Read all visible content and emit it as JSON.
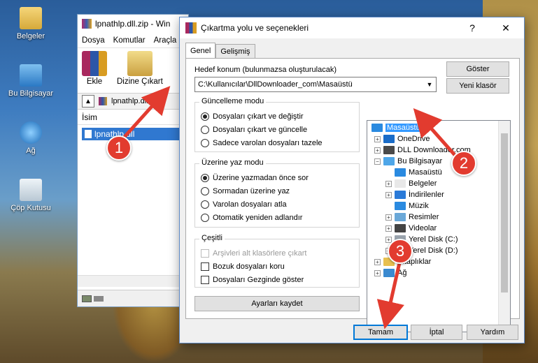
{
  "desktop": {
    "icons": [
      {
        "label": "Belgeler"
      },
      {
        "label": "Bu Bilgisayar"
      },
      {
        "label": "Ağ"
      },
      {
        "label": "Çöp Kutusu"
      }
    ]
  },
  "winrar": {
    "title": "lpnathlp.dll.zip - Win",
    "menu": [
      "Dosya",
      "Komutlar",
      "Araçla"
    ],
    "toolbar": {
      "add": "Ekle",
      "extract": "Dizine Çıkart"
    },
    "address": "lpnathlp.dll.",
    "column_name": "İsim",
    "file": "lpnathlp.dll"
  },
  "dialog": {
    "title": "Çıkartma yolu ve seçenekleri",
    "help": "?",
    "close": "✕",
    "tabs": [
      "Genel",
      "Gelişmiş"
    ],
    "dest_label": "Hedef konum (bulunmazsa oluşturulacak)",
    "dest_value": "C:\\Kullanıcılar\\DllDownloader_com\\Masaüstü",
    "show_button": "Göster",
    "new_folder_button": "Yeni klasör",
    "update_mode": {
      "title": "Güncelleme modu",
      "options": [
        "Dosyaları çıkart ve değiştir",
        "Dosyaları çıkart ve güncelle",
        "Sadece varolan dosyaları tazele"
      ],
      "selected": 0
    },
    "overwrite_mode": {
      "title": "Üzerine yaz modu",
      "options": [
        "Üzerine yazmadan önce sor",
        "Sormadan üzerine yaz",
        "Varolan dosyaları atla",
        "Otomatik yeniden adlandır"
      ],
      "selected": 0
    },
    "misc": {
      "title": "Çeşitli",
      "options": [
        "Arşivleri alt klasörlere çıkart",
        "Bozuk dosyaları koru",
        "Dosyaları Gezginde göster"
      ],
      "disabled": [
        true,
        false,
        false
      ]
    },
    "save_settings": "Ayarları kaydet",
    "tree": [
      {
        "label": "Masaüstü",
        "level": 0,
        "selected": true,
        "icon": "desktop-icon"
      },
      {
        "label": "OneDrive",
        "level": 1,
        "icon": "cloud-icon"
      },
      {
        "label": "DLL Downloader.com",
        "level": 1,
        "icon": "user-icon"
      },
      {
        "label": "Bu Bilgisayar",
        "level": 1,
        "icon": "computer-icon"
      },
      {
        "label": "Masaüstü",
        "level": 2,
        "icon": "desktop-icon"
      },
      {
        "label": "Belgeler",
        "level": 2,
        "icon": "document-icon"
      },
      {
        "label": "İndirilenler",
        "level": 2,
        "icon": "download-icon"
      },
      {
        "label": "Müzik",
        "level": 2,
        "icon": "music-icon"
      },
      {
        "label": "Resimler",
        "level": 2,
        "icon": "picture-icon"
      },
      {
        "label": "Videolar",
        "level": 2,
        "icon": "video-icon"
      },
      {
        "label": "Yerel Disk (C:)",
        "level": 2,
        "icon": "drive-icon"
      },
      {
        "label": "Yerel Disk (D:)",
        "level": 2,
        "icon": "drive-icon"
      },
      {
        "label": "Kitaplıklar",
        "level": 1,
        "icon": "library-icon"
      },
      {
        "label": "Ağ",
        "level": 1,
        "icon": "network-icon"
      }
    ],
    "ok": "Tamam",
    "cancel": "İptal",
    "help_button": "Yardım"
  },
  "markers": [
    "1",
    "2",
    "3"
  ],
  "colors": {
    "marker": "#e23b2f",
    "selection": "#3399ff",
    "default_button_border": "#0078d7"
  }
}
